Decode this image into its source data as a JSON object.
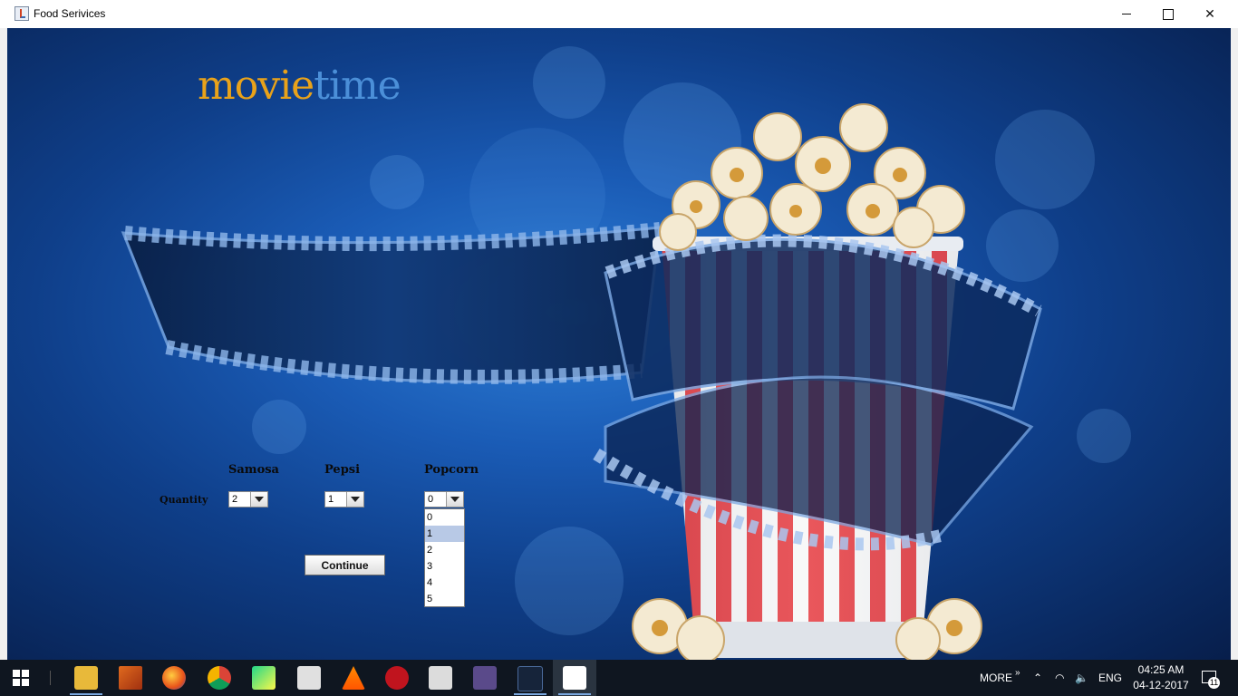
{
  "window": {
    "title": "Food Serivices"
  },
  "logo": {
    "part1": "movie",
    "part2": "time"
  },
  "form": {
    "quantity_label": "Quantity",
    "items": [
      {
        "name": "Samosa",
        "selected": "2"
      },
      {
        "name": "Pepsi",
        "selected": "1"
      },
      {
        "name": "Popcorn",
        "selected": "0"
      }
    ],
    "popcorn_options": [
      "0",
      "1",
      "2",
      "3",
      "4",
      "5"
    ],
    "popcorn_highlighted": "1",
    "continue_label": "Continue"
  },
  "taskbar": {
    "more_label": "MORE",
    "lang": "ENG",
    "time": "04:25 AM",
    "date": "04-12-2017",
    "notifications": "11",
    "pinned_icons": [
      "file-explorer-icon",
      "matlab-icon",
      "firefox-icon",
      "chrome-icon",
      "pycharm-icon",
      "calculator-icon",
      "vlc-icon",
      "garena-icon",
      "document-viewer-icon",
      "age-of-empires-icon",
      "mysql-icon",
      "java-icon"
    ]
  },
  "colors": {
    "logo_orange": "#e8a21a",
    "logo_blue": "#4b8fd8",
    "taskbar": "#0f1620"
  }
}
